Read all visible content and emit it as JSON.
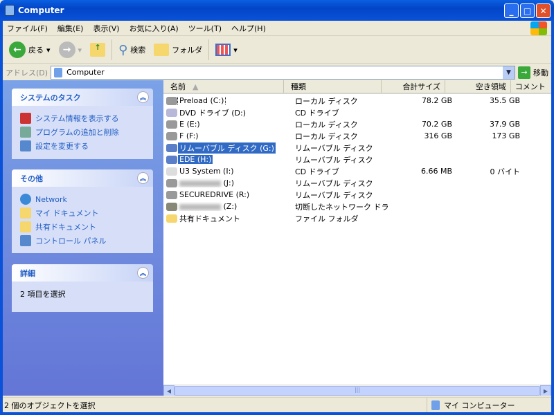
{
  "window": {
    "title": "Computer"
  },
  "menu": [
    "ファイル(F)",
    "編集(E)",
    "表示(V)",
    "お気に入り(A)",
    "ツール(T)",
    "ヘルプ(H)"
  ],
  "toolbar": {
    "back": "戻る",
    "search": "検索",
    "folders": "フォルダ"
  },
  "address": {
    "label": "アドレス(D)",
    "value": "Computer",
    "go": "移動"
  },
  "tasks": {
    "system": {
      "title": "システムのタスク",
      "items": [
        "システム情報を表示する",
        "プログラムの追加と削除",
        "設定を変更する"
      ]
    },
    "other": {
      "title": "その他",
      "items": [
        "Network",
        "マイ ドキュメント",
        "共有ドキュメント",
        "コントロール パネル"
      ]
    },
    "details": {
      "title": "詳細",
      "text": "2 項目を選択"
    }
  },
  "columns": [
    "名前",
    "種類",
    "合計サイズ",
    "空き領域",
    "コメント"
  ],
  "rows": [
    {
      "name": "Preload (C:)",
      "type": "ローカル ディスク",
      "total": "78.2 GB",
      "free": "35.5 GB"
    },
    {
      "name": "DVD ドライブ (D:)",
      "type": "CD ドライブ",
      "total": "",
      "free": ""
    },
    {
      "name": "E (E:)",
      "type": "ローカル ディスク",
      "total": "70.2 GB",
      "free": "37.9 GB"
    },
    {
      "name": "F (F:)",
      "type": "ローカル ディスク",
      "total": "316 GB",
      "free": "173 GB"
    },
    {
      "name": "リムーバブル ディスク (G:)",
      "type": "リムーバブル ディスク",
      "total": "",
      "free": ""
    },
    {
      "name": "EDE (H:)",
      "type": "リムーバブル ディスク",
      "total": "",
      "free": ""
    },
    {
      "name": "U3 System (I:)",
      "type": "CD ドライブ",
      "total": "6.66 MB",
      "free": "0 バイト"
    },
    {
      "name": "(J:)",
      "type": "リムーバブル ディスク",
      "total": "",
      "free": ""
    },
    {
      "name": "SECUREDRIVE (R:)",
      "type": "リムーバブル ディスク",
      "total": "",
      "free": ""
    },
    {
      "name": "(Z:)",
      "type": "切断したネットワーク ドライブ",
      "total": "",
      "free": ""
    },
    {
      "name": "共有ドキュメント",
      "type": "ファイル フォルダ",
      "total": "",
      "free": ""
    }
  ],
  "status": {
    "left": "2 個のオブジェクトを選択",
    "right": "マイ コンピューター"
  }
}
